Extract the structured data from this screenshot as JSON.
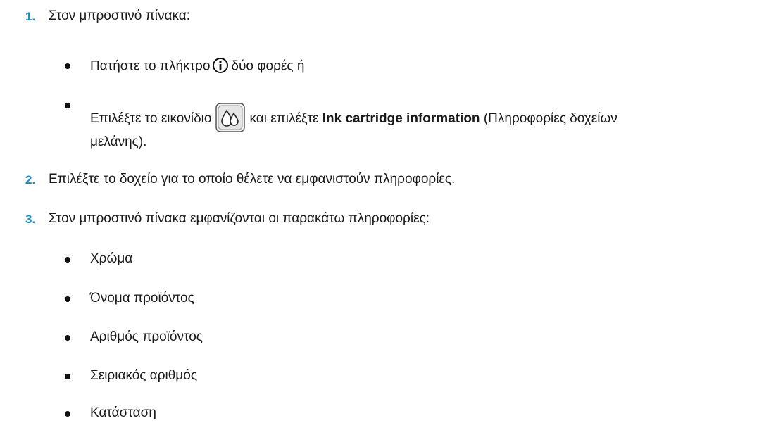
{
  "steps": [
    {
      "number": "1.",
      "text": "Στον μπροστινό πίνακα:"
    },
    {
      "number": "2.",
      "text": "Επιλέξτε το δοχείο για το οποίο θέλετε να εμφανιστούν πληροφορίες."
    },
    {
      "number": "3.",
      "text": "Στον μπροστινό πίνακα εμφανίζονται οι παρακάτω πληροφορίες:"
    }
  ],
  "step1_bullets": {
    "a_before": "Πατήστε το πλήκτρο",
    "a_icon": "info-icon",
    "a_after": "δύο φορές ή",
    "b_before": "Επιλέξτε το εικονίδιο",
    "b_icon": "ink-drops-icon",
    "b_mid": "και επιλέξτε",
    "b_bold": "Ink cartridge information",
    "b_after": "(Πληροφορίες δοχείων",
    "b_cont": "μελάνης)."
  },
  "info_list": [
    "Χρώμα",
    "Όνομα προϊόντος",
    "Αριθμός προϊόντος",
    "Σειριακός αριθμός",
    "Κατάσταση"
  ],
  "colors": {
    "step_number": "#1b8ec2",
    "text": "#1a1a1a"
  }
}
